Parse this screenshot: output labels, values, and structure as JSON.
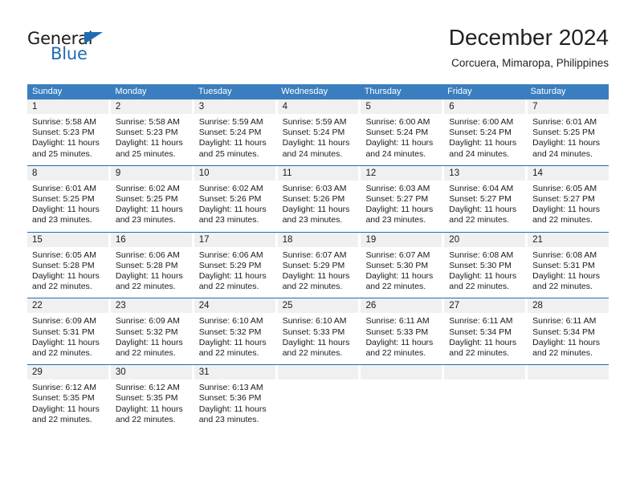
{
  "brand": {
    "name_part1": "General",
    "name_part2": "Blue",
    "accent_color": "#1f6cb4"
  },
  "header": {
    "title": "December 2024",
    "subtitle": "Corcuera, Mimaropa, Philippines"
  },
  "calendar": {
    "header_bg": "#3a7ebf",
    "day_number_bg": "#f0f0f0",
    "row_divider_color": "#1f6cb4",
    "weekday_headers": [
      "Sunday",
      "Monday",
      "Tuesday",
      "Wednesday",
      "Thursday",
      "Friday",
      "Saturday"
    ],
    "weeks": [
      [
        {
          "day": "1",
          "sunrise": "Sunrise: 5:58 AM",
          "sunset": "Sunset: 5:23 PM",
          "daylight": "Daylight: 11 hours and 25 minutes."
        },
        {
          "day": "2",
          "sunrise": "Sunrise: 5:58 AM",
          "sunset": "Sunset: 5:23 PM",
          "daylight": "Daylight: 11 hours and 25 minutes."
        },
        {
          "day": "3",
          "sunrise": "Sunrise: 5:59 AM",
          "sunset": "Sunset: 5:24 PM",
          "daylight": "Daylight: 11 hours and 25 minutes."
        },
        {
          "day": "4",
          "sunrise": "Sunrise: 5:59 AM",
          "sunset": "Sunset: 5:24 PM",
          "daylight": "Daylight: 11 hours and 24 minutes."
        },
        {
          "day": "5",
          "sunrise": "Sunrise: 6:00 AM",
          "sunset": "Sunset: 5:24 PM",
          "daylight": "Daylight: 11 hours and 24 minutes."
        },
        {
          "day": "6",
          "sunrise": "Sunrise: 6:00 AM",
          "sunset": "Sunset: 5:24 PM",
          "daylight": "Daylight: 11 hours and 24 minutes."
        },
        {
          "day": "7",
          "sunrise": "Sunrise: 6:01 AM",
          "sunset": "Sunset: 5:25 PM",
          "daylight": "Daylight: 11 hours and 24 minutes."
        }
      ],
      [
        {
          "day": "8",
          "sunrise": "Sunrise: 6:01 AM",
          "sunset": "Sunset: 5:25 PM",
          "daylight": "Daylight: 11 hours and 23 minutes."
        },
        {
          "day": "9",
          "sunrise": "Sunrise: 6:02 AM",
          "sunset": "Sunset: 5:25 PM",
          "daylight": "Daylight: 11 hours and 23 minutes."
        },
        {
          "day": "10",
          "sunrise": "Sunrise: 6:02 AM",
          "sunset": "Sunset: 5:26 PM",
          "daylight": "Daylight: 11 hours and 23 minutes."
        },
        {
          "day": "11",
          "sunrise": "Sunrise: 6:03 AM",
          "sunset": "Sunset: 5:26 PM",
          "daylight": "Daylight: 11 hours and 23 minutes."
        },
        {
          "day": "12",
          "sunrise": "Sunrise: 6:03 AM",
          "sunset": "Sunset: 5:27 PM",
          "daylight": "Daylight: 11 hours and 23 minutes."
        },
        {
          "day": "13",
          "sunrise": "Sunrise: 6:04 AM",
          "sunset": "Sunset: 5:27 PM",
          "daylight": "Daylight: 11 hours and 22 minutes."
        },
        {
          "day": "14",
          "sunrise": "Sunrise: 6:05 AM",
          "sunset": "Sunset: 5:27 PM",
          "daylight": "Daylight: 11 hours and 22 minutes."
        }
      ],
      [
        {
          "day": "15",
          "sunrise": "Sunrise: 6:05 AM",
          "sunset": "Sunset: 5:28 PM",
          "daylight": "Daylight: 11 hours and 22 minutes."
        },
        {
          "day": "16",
          "sunrise": "Sunrise: 6:06 AM",
          "sunset": "Sunset: 5:28 PM",
          "daylight": "Daylight: 11 hours and 22 minutes."
        },
        {
          "day": "17",
          "sunrise": "Sunrise: 6:06 AM",
          "sunset": "Sunset: 5:29 PM",
          "daylight": "Daylight: 11 hours and 22 minutes."
        },
        {
          "day": "18",
          "sunrise": "Sunrise: 6:07 AM",
          "sunset": "Sunset: 5:29 PM",
          "daylight": "Daylight: 11 hours and 22 minutes."
        },
        {
          "day": "19",
          "sunrise": "Sunrise: 6:07 AM",
          "sunset": "Sunset: 5:30 PM",
          "daylight": "Daylight: 11 hours and 22 minutes."
        },
        {
          "day": "20",
          "sunrise": "Sunrise: 6:08 AM",
          "sunset": "Sunset: 5:30 PM",
          "daylight": "Daylight: 11 hours and 22 minutes."
        },
        {
          "day": "21",
          "sunrise": "Sunrise: 6:08 AM",
          "sunset": "Sunset: 5:31 PM",
          "daylight": "Daylight: 11 hours and 22 minutes."
        }
      ],
      [
        {
          "day": "22",
          "sunrise": "Sunrise: 6:09 AM",
          "sunset": "Sunset: 5:31 PM",
          "daylight": "Daylight: 11 hours and 22 minutes."
        },
        {
          "day": "23",
          "sunrise": "Sunrise: 6:09 AM",
          "sunset": "Sunset: 5:32 PM",
          "daylight": "Daylight: 11 hours and 22 minutes."
        },
        {
          "day": "24",
          "sunrise": "Sunrise: 6:10 AM",
          "sunset": "Sunset: 5:32 PM",
          "daylight": "Daylight: 11 hours and 22 minutes."
        },
        {
          "day": "25",
          "sunrise": "Sunrise: 6:10 AM",
          "sunset": "Sunset: 5:33 PM",
          "daylight": "Daylight: 11 hours and 22 minutes."
        },
        {
          "day": "26",
          "sunrise": "Sunrise: 6:11 AM",
          "sunset": "Sunset: 5:33 PM",
          "daylight": "Daylight: 11 hours and 22 minutes."
        },
        {
          "day": "27",
          "sunrise": "Sunrise: 6:11 AM",
          "sunset": "Sunset: 5:34 PM",
          "daylight": "Daylight: 11 hours and 22 minutes."
        },
        {
          "day": "28",
          "sunrise": "Sunrise: 6:11 AM",
          "sunset": "Sunset: 5:34 PM",
          "daylight": "Daylight: 11 hours and 22 minutes."
        }
      ],
      [
        {
          "day": "29",
          "sunrise": "Sunrise: 6:12 AM",
          "sunset": "Sunset: 5:35 PM",
          "daylight": "Daylight: 11 hours and 22 minutes."
        },
        {
          "day": "30",
          "sunrise": "Sunrise: 6:12 AM",
          "sunset": "Sunset: 5:35 PM",
          "daylight": "Daylight: 11 hours and 22 minutes."
        },
        {
          "day": "31",
          "sunrise": "Sunrise: 6:13 AM",
          "sunset": "Sunset: 5:36 PM",
          "daylight": "Daylight: 11 hours and 23 minutes."
        },
        {
          "day": "",
          "sunrise": "",
          "sunset": "",
          "daylight": ""
        },
        {
          "day": "",
          "sunrise": "",
          "sunset": "",
          "daylight": ""
        },
        {
          "day": "",
          "sunrise": "",
          "sunset": "",
          "daylight": ""
        },
        {
          "day": "",
          "sunrise": "",
          "sunset": "",
          "daylight": ""
        }
      ]
    ]
  }
}
